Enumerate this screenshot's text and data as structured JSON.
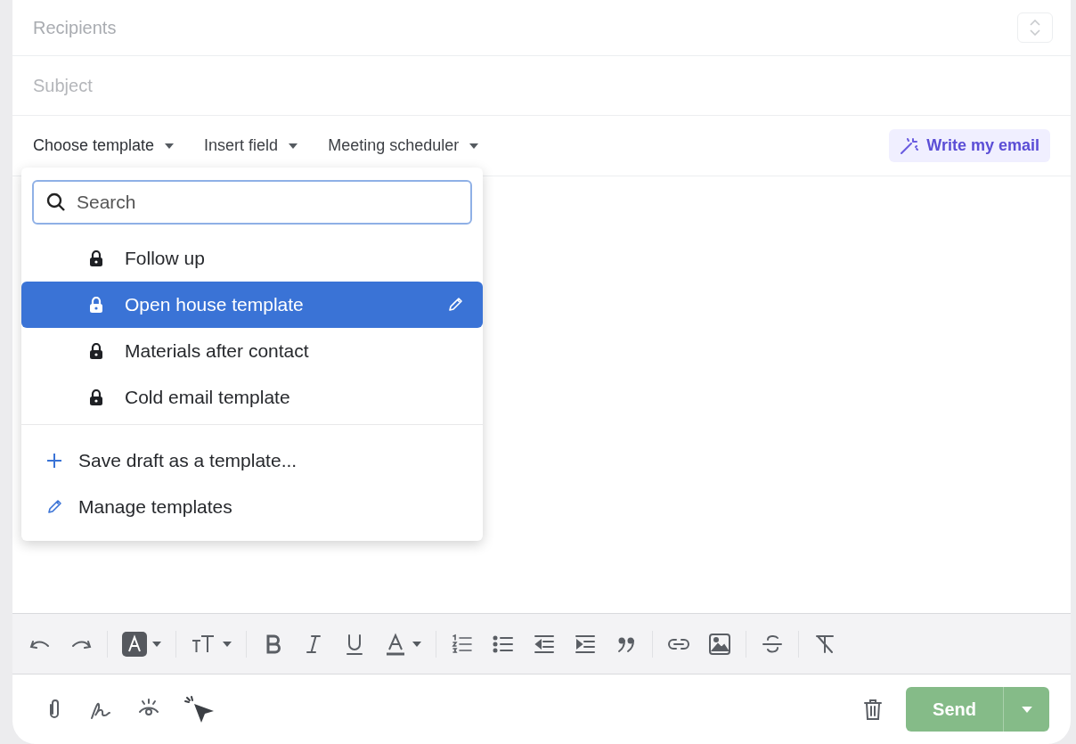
{
  "recipients": {
    "placeholder": "Recipients"
  },
  "subject": {
    "placeholder": "Subject"
  },
  "compose_toolbar": {
    "menus": [
      {
        "label": "Choose template",
        "expanded": true
      },
      {
        "label": "Insert field",
        "expanded": false
      },
      {
        "label": "Meeting scheduler",
        "expanded": false
      }
    ],
    "write_button": "Write my email"
  },
  "template_menu": {
    "search": {
      "placeholder": "Search"
    },
    "templates": [
      {
        "label": "Follow up",
        "selected": false
      },
      {
        "label": "Open house template",
        "selected": true
      },
      {
        "label": "Materials after contact",
        "selected": false
      },
      {
        "label": "Cold email template",
        "selected": false
      }
    ],
    "actions": [
      {
        "label": "Save draft as a template...",
        "kind": "add"
      },
      {
        "label": "Manage templates",
        "kind": "manage"
      }
    ]
  },
  "send_button": {
    "label": "Send"
  }
}
